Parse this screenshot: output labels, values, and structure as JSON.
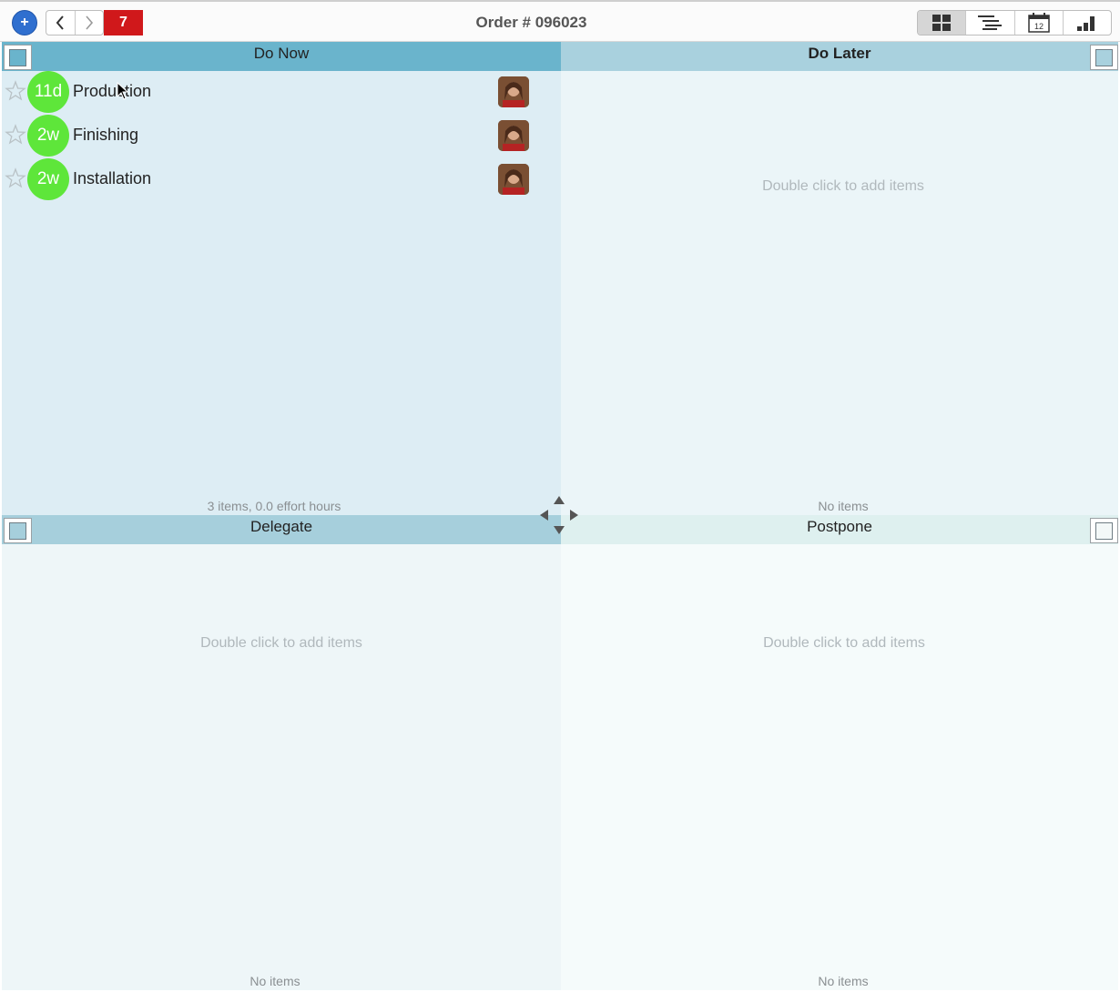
{
  "toolbar": {
    "add_icon": "plus-icon",
    "back_icon": "chevron-left-icon",
    "forward_icon": "chevron-right-icon",
    "count": "7",
    "title": "Order # 096023",
    "views": [
      "grid-view-icon",
      "outline-view-icon",
      "calendar-view-icon",
      "chart-view-icon"
    ],
    "calendar_day": "12"
  },
  "quadrants": {
    "do_now": {
      "title": "Do Now",
      "footer": "3 items, 0.0 effort hours",
      "tasks": [
        {
          "due": "11d",
          "name": "Production"
        },
        {
          "due": "2w",
          "name": "Finishing"
        },
        {
          "due": "2w",
          "name": "Installation"
        }
      ]
    },
    "do_later": {
      "title": "Do Later",
      "hint": "Double click to add items",
      "footer": "No items"
    },
    "delegate": {
      "title": "Delegate",
      "hint": "Double click to add items",
      "footer": "No items"
    },
    "postpone": {
      "title": "Postpone",
      "hint": "Double click to add items",
      "footer": "No items"
    }
  },
  "colors": {
    "accent": "#2f6fcf",
    "badge": "#d0181b",
    "due_badge": "#5ee63a",
    "do_now_header": "#6ab4cc"
  }
}
